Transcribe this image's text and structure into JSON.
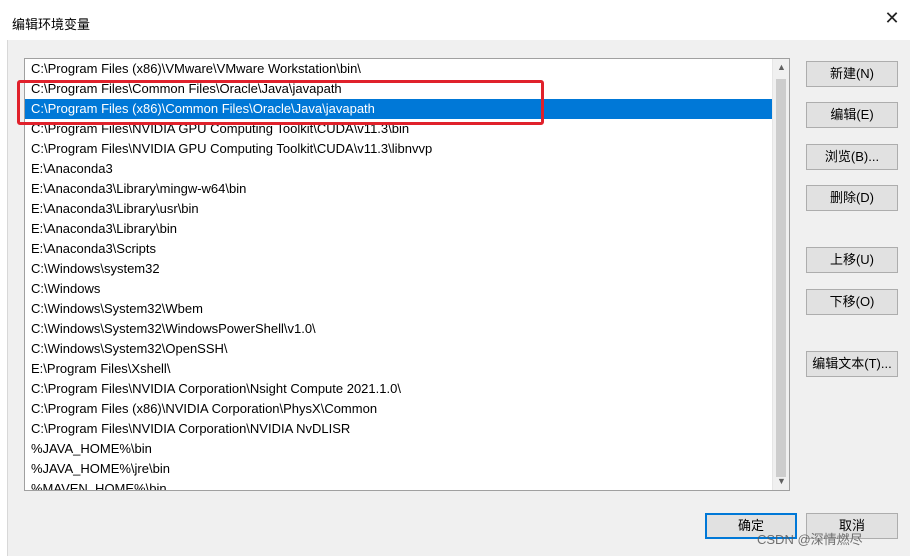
{
  "window": {
    "title": "编辑环境变量"
  },
  "list": {
    "items": [
      "C:\\Program Files (x86)\\VMware\\VMware Workstation\\bin\\",
      "C:\\Program Files\\Common Files\\Oracle\\Java\\javapath",
      "C:\\Program Files (x86)\\Common Files\\Oracle\\Java\\javapath",
      "C:\\Program Files\\NVIDIA GPU Computing Toolkit\\CUDA\\v11.3\\bin",
      "C:\\Program Files\\NVIDIA GPU Computing Toolkit\\CUDA\\v11.3\\libnvvp",
      "E:\\Anaconda3",
      "E:\\Anaconda3\\Library\\mingw-w64\\bin",
      "E:\\Anaconda3\\Library\\usr\\bin",
      "E:\\Anaconda3\\Library\\bin",
      "E:\\Anaconda3\\Scripts",
      "C:\\Windows\\system32",
      "C:\\Windows",
      "C:\\Windows\\System32\\Wbem",
      "C:\\Windows\\System32\\WindowsPowerShell\\v1.0\\",
      "C:\\Windows\\System32\\OpenSSH\\",
      "E:\\Program Files\\Xshell\\",
      "C:\\Program Files\\NVIDIA Corporation\\Nsight Compute 2021.1.0\\",
      "C:\\Program Files (x86)\\NVIDIA Corporation\\PhysX\\Common",
      "C:\\Program Files\\NVIDIA Corporation\\NVIDIA NvDLISR",
      "%JAVA_HOME%\\bin",
      "%JAVA_HOME%\\jre\\bin",
      "%MAVEN_HOME%\\bin"
    ],
    "selected_index": 2
  },
  "buttons": {
    "new": "新建(N)",
    "edit": "编辑(E)",
    "browse": "浏览(B)...",
    "delete": "删除(D)",
    "move_up": "上移(U)",
    "move_down": "下移(O)",
    "edit_text": "编辑文本(T)...",
    "ok": "确定",
    "cancel": "取消"
  },
  "watermark": "CSDN @深情燃尽",
  "colors": {
    "selection": "#0078d7",
    "highlight_box": "#e0212b"
  }
}
